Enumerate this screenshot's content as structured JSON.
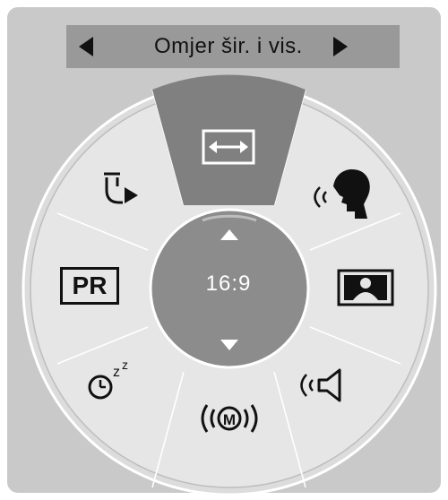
{
  "header": {
    "title": "Omjer šir. i vis.",
    "prev_icon": "left-triangle-arrow",
    "next_icon": "right-triangle-arrow"
  },
  "center": {
    "value": "16:9",
    "up_icon": "up-arrow",
    "down_icon": "down-arrow"
  },
  "menu": {
    "selected": "aspect-ratio",
    "items": [
      {
        "name": "aspect-ratio",
        "icon": "aspect-ratio-icon"
      },
      {
        "name": "clear-voice",
        "icon": "speaking-head-icon"
      },
      {
        "name": "picture-mode",
        "icon": "picture-icon"
      },
      {
        "name": "sound-mode",
        "icon": "speaker-icon"
      },
      {
        "name": "mono-stereo",
        "icon": "mono-m-icon"
      },
      {
        "name": "sleep-timer",
        "icon": "sleep-clock-icon"
      },
      {
        "name": "program",
        "icon": "pr-icon",
        "label": "PR"
      },
      {
        "name": "exit",
        "icon": "exit-icon"
      }
    ]
  },
  "colors": {
    "panel": "#c9c9c9",
    "titlebar": "#999999",
    "wheel": "#e6e6e6",
    "selected": "#808080",
    "center": "#8c8c8c",
    "icon": "#111111"
  }
}
